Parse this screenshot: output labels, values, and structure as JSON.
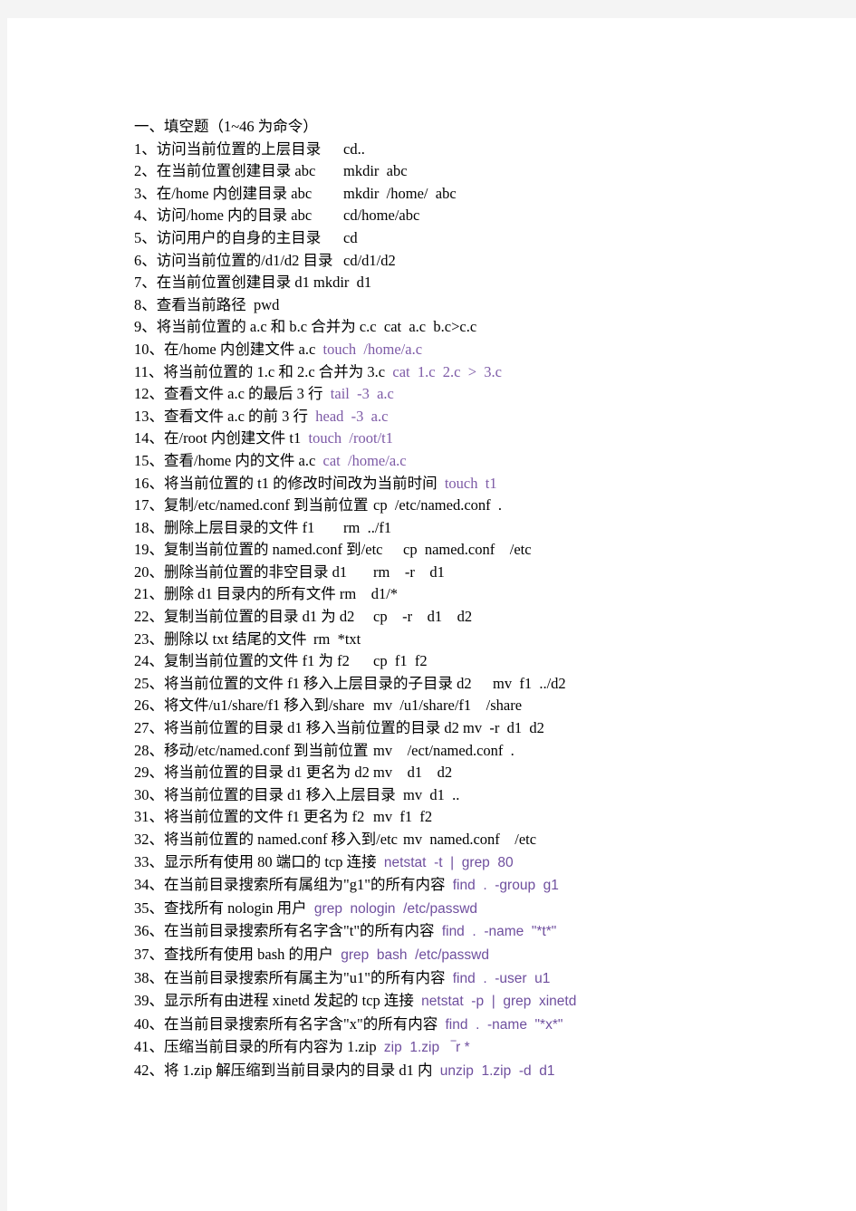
{
  "document": {
    "title_line": "一、填空题（1~46 为命令）",
    "items": [
      {
        "n": "1、",
        "prompt": "访问当前位置的上层目录",
        "gap": "\t",
        "answer": "cd..",
        "style": "cmd-black"
      },
      {
        "n": "2、",
        "prompt": "在当前位置创建目录 abc",
        "gap": "\t",
        "answer": "mkdir  abc",
        "style": "cmd-black"
      },
      {
        "n": "3、",
        "prompt": "在/home 内创建目录 abc",
        "gap": "\t",
        "answer": "mkdir  /home/  abc",
        "style": "cmd-black"
      },
      {
        "n": "4、",
        "prompt": "访问/home 内的目录 abc",
        "gap": "\t",
        "answer": "cd/home/abc",
        "style": "cmd-black"
      },
      {
        "n": "5、",
        "prompt": "访问用户的自身的主目录",
        "gap": "\t",
        "answer": "cd",
        "style": "cmd-black"
      },
      {
        "n": "6、",
        "prompt": "访问当前位置的/d1/d2 目录",
        "gap": "\t",
        "answer": "cd/d1/d2",
        "style": "cmd-black"
      },
      {
        "n": "7、",
        "prompt": "在当前位置创建目录 d1",
        "gap": "\t",
        "answer": "mkdir  d1",
        "style": "cmd-black"
      },
      {
        "n": "8、",
        "prompt": "查看当前路径",
        "gap": "  ",
        "answer": "pwd",
        "style": "cmd-black"
      },
      {
        "n": "9、",
        "prompt": "将当前位置的 a.c 和 b.c 合并为 c.c",
        "gap": "  ",
        "answer": "cat  a.c  b.c>c.c",
        "style": "cmd-black"
      },
      {
        "n": "10、",
        "prompt": "在/home 内创建文件 a.c",
        "gap": "  ",
        "answer": "touch  /home/a.c",
        "style": "cmd-violet"
      },
      {
        "n": "11、",
        "prompt": "将当前位置的 1.c 和 2.c 合并为 3.c",
        "gap": "  ",
        "answer": "cat  1.c  2.c  >  3.c",
        "style": "cmd-violet"
      },
      {
        "n": "12、",
        "prompt": "查看文件 a.c 的最后 3 行",
        "gap": "  ",
        "answer": "tail  -3  a.c",
        "style": "cmd-violet"
      },
      {
        "n": "13、",
        "prompt": "查看文件 a.c 的前 3 行",
        "gap": "  ",
        "answer": "head  -3  a.c",
        "style": "cmd-violet"
      },
      {
        "n": "14、",
        "prompt": "在/root 内创建文件 t1",
        "gap": "  ",
        "answer": "touch  /root/t1",
        "style": "cmd-violet"
      },
      {
        "n": "15、",
        "prompt": "查看/home 内的文件 a.c",
        "gap": "  ",
        "answer": "cat  /home/a.c",
        "style": "cmd-violet"
      },
      {
        "n": "16、",
        "prompt": "将当前位置的 t1 的修改时间改为当前时间",
        "gap": "  ",
        "answer": "touch  t1",
        "style": "cmd-violet"
      },
      {
        "n": "17、",
        "prompt": "复制/etc/named.conf 到当前位置",
        "gap": "\t",
        "answer": "cp  /etc/named.conf  .",
        "style": "cmd-black"
      },
      {
        "n": "18、",
        "prompt": "删除上层目录的文件 f1",
        "gap": "\t",
        "answer": "rm  ../f1",
        "style": "cmd-black"
      },
      {
        "n": "19、",
        "prompt": "复制当前位置的 named.conf 到/etc",
        "gap": "\t",
        "answer": "cp  named.conf    /etc",
        "style": "cmd-black"
      },
      {
        "n": "20、",
        "prompt": "删除当前位置的非空目录 d1",
        "gap": "\t",
        "answer": "rm    -r    d1",
        "style": "cmd-black"
      },
      {
        "n": "21、",
        "prompt": "删除 d1 目录内的所有文件",
        "gap": " ",
        "answer": "rm    d1/*",
        "style": "cmd-black"
      },
      {
        "n": "22、",
        "prompt": "复制当前位置的目录 d1 为 d2",
        "gap": "\t",
        "answer": "cp    -r    d1    d2",
        "style": "cmd-black"
      },
      {
        "n": "23、",
        "prompt": "删除以 txt 结尾的文件",
        "gap": "\t",
        "answer": "rm  *txt",
        "style": "cmd-black"
      },
      {
        "n": "24、",
        "prompt": "复制当前位置的文件 f1 为 f2",
        "gap": "\t",
        "answer": "cp  f1  f2",
        "style": "cmd-black"
      },
      {
        "n": "25、",
        "prompt": "将当前位置的文件 f1 移入上层目录的子目录 d2",
        "gap": "\t",
        "answer": "mv  f1  ../d2",
        "style": "cmd-black"
      },
      {
        "n": "26、",
        "prompt": "将文件/u1/share/f1 移入到/share",
        "gap": "\t",
        "answer": "mv  /u1/share/f1    /share",
        "style": "cmd-black"
      },
      {
        "n": "27、",
        "prompt": "将当前位置的目录 d1 移入当前位置的目录 d2",
        "gap": "\t",
        "answer": "mv  -r  d1  d2",
        "style": "cmd-black"
      },
      {
        "n": "28、",
        "prompt": "移动/etc/named.conf 到当前位置",
        "gap": "\t",
        "answer": "mv    /ect/named.conf  .",
        "style": "cmd-black"
      },
      {
        "n": "29、",
        "prompt": "将当前位置的目录 d1 更名为 d2",
        "gap": "\t",
        "answer": "mv    d1    d2",
        "style": "cmd-black"
      },
      {
        "n": "30、",
        "prompt": "将当前位置的目录 d1 移入上层目录",
        "gap": "\t",
        "answer": "mv  d1  ..",
        "style": "cmd-black"
      },
      {
        "n": "31、",
        "prompt": "将当前位置的文件 f1 更名为 f2",
        "gap": "\t",
        "answer": "mv  f1  f2",
        "style": "cmd-black"
      },
      {
        "n": "32、",
        "prompt": "将当前位置的 named.conf 移入到/etc",
        "gap": "\t",
        "answer": "mv  named.conf    /etc",
        "style": "cmd-black"
      },
      {
        "n": "33、",
        "prompt": "显示所有使用 80 端口的 tcp 连接",
        "gap": "  ",
        "answer": "netstat  -t  |  grep  80",
        "style": "cmd-violet-sans"
      },
      {
        "n": "34、",
        "prompt": "在当前目录搜索所有属组为\"g1\"的所有内容",
        "gap": "  ",
        "answer": "find  .  -group  g1",
        "style": "cmd-violet-sans"
      },
      {
        "n": "35、",
        "prompt": "查找所有 nologin 用户",
        "gap": "  ",
        "answer": "grep  nologin  /etc/passwd",
        "style": "cmd-violet-sans"
      },
      {
        "n": "36、",
        "prompt": "在当前目录搜索所有名字含\"t\"的所有内容",
        "gap": "  ",
        "answer": "find  .  -name  \"*t*\"",
        "style": "cmd-violet-sans"
      },
      {
        "n": "37、",
        "prompt": "查找所有使用 bash 的用户",
        "gap": "  ",
        "answer": "grep  bash  /etc/passwd",
        "style": "cmd-violet-sans"
      },
      {
        "n": "38、",
        "prompt": "在当前目录搜索所有属主为\"u1\"的所有内容",
        "gap": "  ",
        "answer": "find  .  -user  u1",
        "style": "cmd-violet-sans"
      },
      {
        "n": "39、",
        "prompt": "显示所有由进程 xinetd 发起的 tcp 连接",
        "gap": "  ",
        "answer": "netstat  -p  |  grep  xinetd",
        "style": "cmd-violet-sans"
      },
      {
        "n": "40、",
        "prompt": "在当前目录搜索所有名字含\"x\"的所有内容",
        "gap": "  ",
        "answer": "find  .  -name  \"*x*\"",
        "style": "cmd-violet-sans"
      },
      {
        "n": "41、",
        "prompt": "压缩当前目录的所有内容为 1.zip",
        "gap": "  ",
        "answer": "zip  1.zip   ‾r *",
        "style": "cmd-violet-sans"
      },
      {
        "n": "42、",
        "prompt": "将 1.zip 解压缩到当前目录内的目录 d1 内",
        "gap": "  ",
        "answer": "unzip  1.zip  -d  d1",
        "style": "cmd-violet-sans"
      }
    ],
    "colors": {
      "paper": "#ffffff",
      "gutter": "#f4f4f4",
      "ink_black": "#000000",
      "ink_violet_serif": "#7d5aa6",
      "ink_violet_sans": "#6f4f9e"
    }
  }
}
